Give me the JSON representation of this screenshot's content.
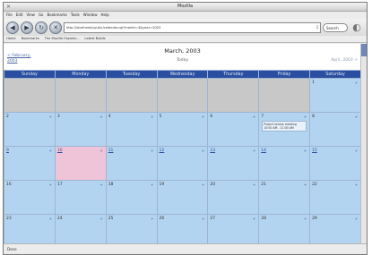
{
  "window": {
    "title": "Mozilla",
    "close_glyph": "×"
  },
  "menu": [
    "File",
    "Edit",
    "View",
    "Go",
    "Bookmarks",
    "Tools",
    "Window",
    "Help"
  ],
  "nav": {
    "back_icon": "◀",
    "forward_icon": "▶",
    "reload_icon": "↻",
    "stop_icon": "✕",
    "url": "http://localhost/cgi-bin/calendar.cgi?month=3&year=2003",
    "url_go_icon": "⇩",
    "search_label": "Search",
    "throbber_icon": "◐"
  },
  "bookmarks": [
    "Home",
    "Bookmarks",
    "The Mozilla Organiz...",
    "Latest Builds"
  ],
  "calendar": {
    "title": "March, 2003",
    "prev_month": "< February,",
    "prev_year": "2003",
    "today_label": "Today",
    "next_month": "April, 2003  >",
    "weekdays": [
      "Sunday",
      "Monday",
      "Tuesday",
      "Wednesday",
      "Thursday",
      "Friday",
      "Saturday"
    ],
    "add_icon": "+",
    "weeks": [
      [
        {
          "day": "",
          "empty": true
        },
        {
          "day": "",
          "empty": true
        },
        {
          "day": "",
          "empty": true
        },
        {
          "day": "",
          "empty": true
        },
        {
          "day": "",
          "empty": true
        },
        {
          "day": "",
          "empty": true
        },
        {
          "day": "1"
        }
      ],
      [
        {
          "day": "2"
        },
        {
          "day": "3"
        },
        {
          "day": "4"
        },
        {
          "day": "5"
        },
        {
          "day": "6"
        },
        {
          "day": "7",
          "event": "Project review meeting 10:00 AM - 11:00 AM"
        },
        {
          "day": "8"
        }
      ],
      [
        {
          "day": "9",
          "link": true
        },
        {
          "day": "10",
          "link": true,
          "today": true
        },
        {
          "day": "11",
          "link": true
        },
        {
          "day": "12",
          "link": true
        },
        {
          "day": "13",
          "link": true
        },
        {
          "day": "14",
          "link": true
        },
        {
          "day": "15",
          "link": true
        }
      ],
      [
        {
          "day": "16"
        },
        {
          "day": "17"
        },
        {
          "day": "18"
        },
        {
          "day": "19"
        },
        {
          "day": "20"
        },
        {
          "day": "21"
        },
        {
          "day": "22"
        }
      ],
      [
        {
          "day": "23"
        },
        {
          "day": "24"
        },
        {
          "day": "25"
        },
        {
          "day": "26"
        },
        {
          "day": "27"
        },
        {
          "day": "28"
        },
        {
          "day": "29"
        }
      ]
    ]
  },
  "status": "Done"
}
